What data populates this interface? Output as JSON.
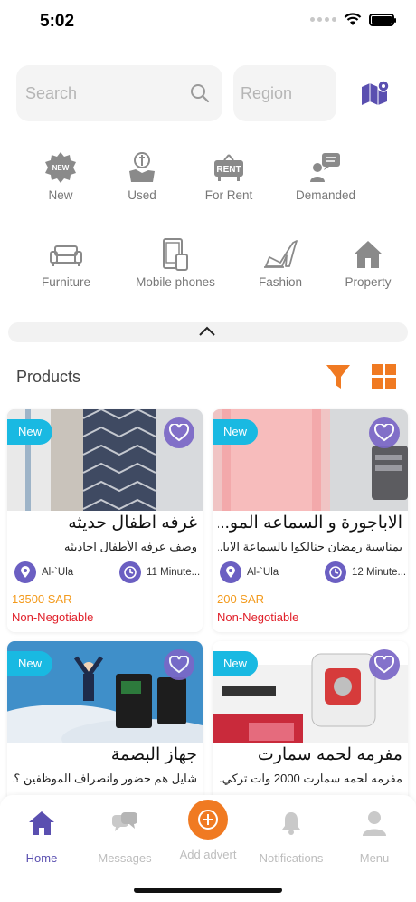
{
  "status": {
    "time": "5:02"
  },
  "search": {
    "placeholder": "Search"
  },
  "region": {
    "placeholder": "Region"
  },
  "categories": [
    {
      "label": "New",
      "icon": "new-badge-icon"
    },
    {
      "label": "Used",
      "icon": "used-hand-icon"
    },
    {
      "label": "For Rent",
      "icon": "rent-sign-icon"
    },
    {
      "label": "Demanded",
      "icon": "demanded-person-icon"
    },
    {
      "label": "Furniture",
      "icon": "sofa-icon"
    },
    {
      "label": "Mobile phones",
      "icon": "mobile-phone-icon"
    },
    {
      "label": "Fashion",
      "icon": "high-heel-icon"
    },
    {
      "label": "Property",
      "icon": "house-icon"
    }
  ],
  "products": {
    "title": "Products",
    "items": [
      {
        "badge": "New",
        "title": "غرفه اطفال حديثه",
        "description": "وصف عرفه الأطفال احاديثه",
        "location": "Al-`Ula",
        "time": "11 Minute...",
        "price": "13500 SAR",
        "negotiable": "Non-Negotiable"
      },
      {
        "badge": "New",
        "title": "الاباجورة و السماعه المو...",
        "description": "بمناسبة رمضان جنالكوا بالسماعة الابا...",
        "location": "Al-`Ula",
        "time": "12 Minute...",
        "price": "200 SAR",
        "negotiable": "Non-Negotiable"
      },
      {
        "badge": "New",
        "title": "جهاز البصمة",
        "description": "شايل هم حضور وانصراف الموظفين ؟...",
        "location": "",
        "time": "",
        "price": "",
        "negotiable": ""
      },
      {
        "badge": "New",
        "title": "مفرمه لحمه سمارت",
        "description": "مفرمه لحمه سمارت 2000 وات تركي...",
        "location": "",
        "time": "",
        "price": "",
        "negotiable": ""
      }
    ]
  },
  "nav": [
    {
      "label": "Home",
      "icon": "home-icon",
      "active": true
    },
    {
      "label": "Messages",
      "icon": "chat-bubbles-icon"
    },
    {
      "label": "Add advert",
      "icon": "add-icon"
    },
    {
      "label": "Notifications",
      "icon": "bell-icon"
    },
    {
      "label": "Menu",
      "icon": "user-icon"
    }
  ],
  "colors": {
    "accent": "#5a4fb0",
    "orange": "#f07a22",
    "badge": "#19b9e2",
    "price": "#f39a1c",
    "negotiable": "#e0202a"
  }
}
